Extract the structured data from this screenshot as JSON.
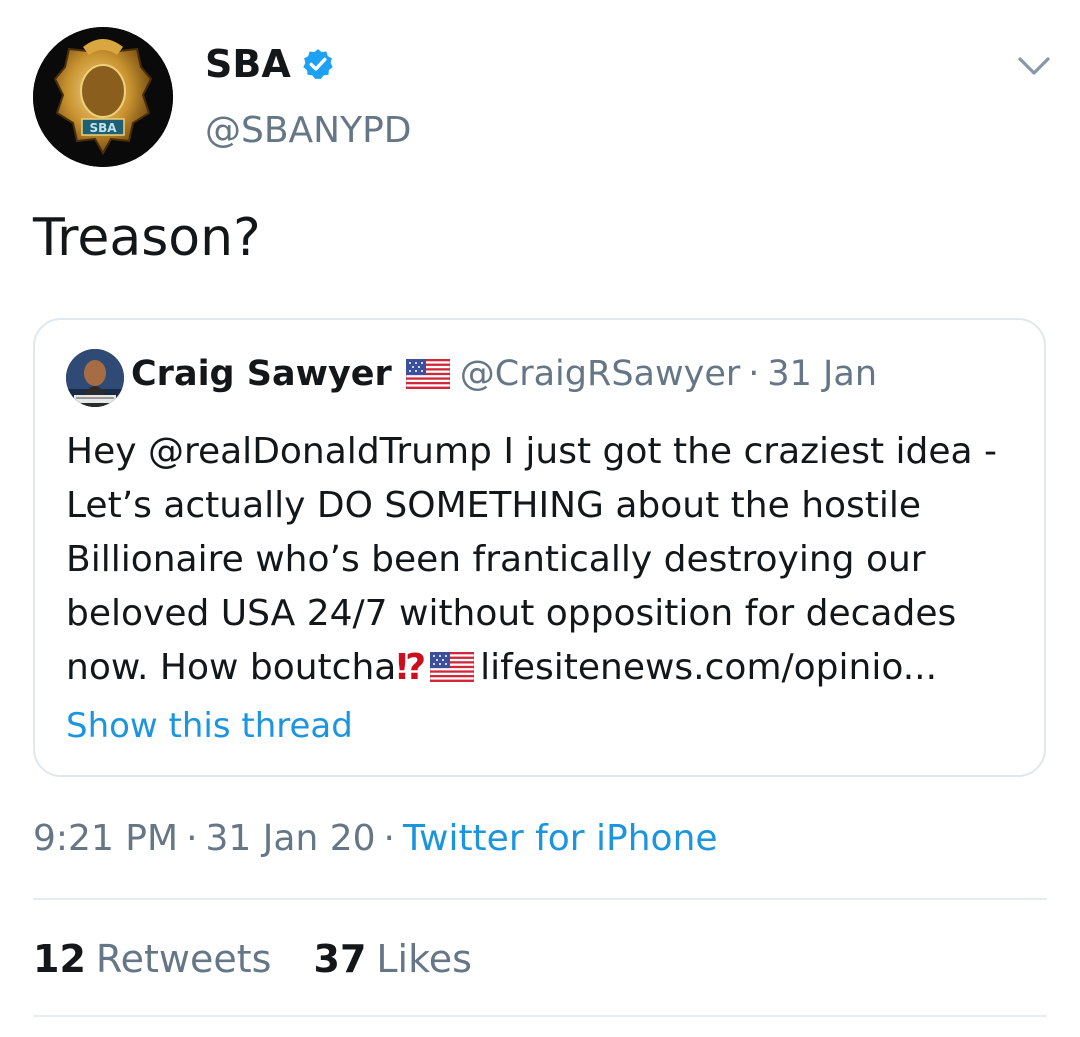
{
  "tweet": {
    "author": {
      "name": "SBA",
      "handle": "@SBANYPD",
      "verified": true,
      "avatar_icon": "police-badge-avatar",
      "verified_icon": "verified-badge-icon"
    },
    "text": "Treason?",
    "menu_icon": "chevron-down-icon",
    "quoted": {
      "author_name": "Craig Sawyer",
      "author_flag": "us-flag-icon",
      "handle": "@CraigRSawyer",
      "separator": "·",
      "date": "31 Jan",
      "body_lines": [
        "Hey @realDonaldTrump I just got the craziest idea -",
        "Let’s actually DO SOMETHING about the hostile",
        "Billionaire who’s been frantically destroying our",
        "beloved USA 24/7 without opposition for decades"
      ],
      "last_line_prefix": "now. How boutcha",
      "interrobang": "⁉",
      "link": "lifesitenews.com/opinio...",
      "show_thread": "Show this thread"
    },
    "meta": {
      "time": "9:21 PM",
      "sep1": "·",
      "date": "31 Jan 20",
      "sep2": "·",
      "source": "Twitter for iPhone"
    },
    "stats": {
      "retweets_count": "12",
      "retweets_label": "Retweets",
      "likes_count": "37",
      "likes_label": "Likes"
    }
  },
  "colors": {
    "text": "#14171a",
    "secondary": "#657786",
    "link_blue": "#1b95e0",
    "verified_blue": "#1da1f2",
    "border": "#e1e8ed",
    "interrobang_red": "#cc0f1e"
  }
}
